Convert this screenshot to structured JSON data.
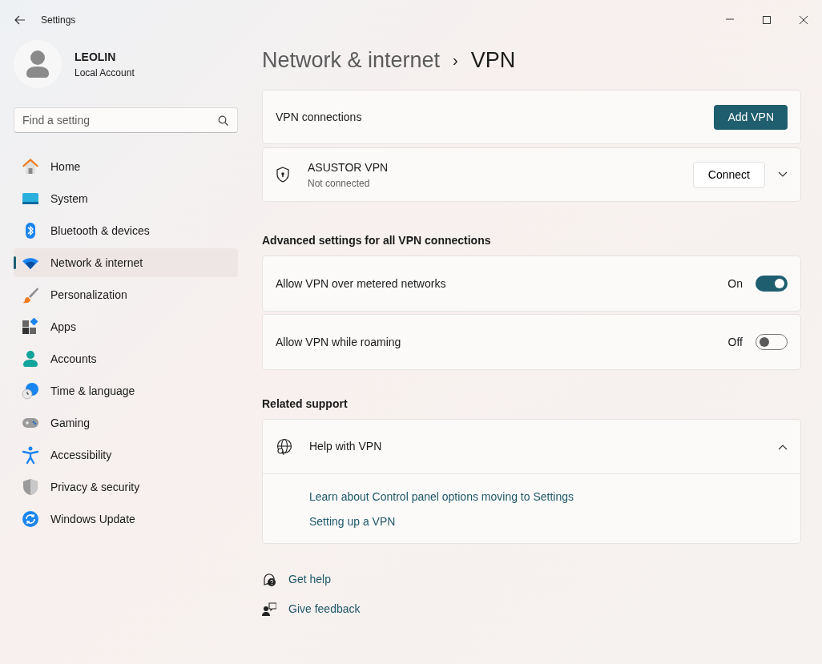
{
  "window": {
    "title": "Settings"
  },
  "account": {
    "name": "LEOLIN",
    "type": "Local Account"
  },
  "search": {
    "placeholder": "Find a setting"
  },
  "sidebar": {
    "items": [
      {
        "label": "Home",
        "selected": false
      },
      {
        "label": "System",
        "selected": false
      },
      {
        "label": "Bluetooth & devices",
        "selected": false
      },
      {
        "label": "Network & internet",
        "selected": true
      },
      {
        "label": "Personalization",
        "selected": false
      },
      {
        "label": "Apps",
        "selected": false
      },
      {
        "label": "Accounts",
        "selected": false
      },
      {
        "label": "Time & language",
        "selected": false
      },
      {
        "label": "Gaming",
        "selected": false
      },
      {
        "label": "Accessibility",
        "selected": false
      },
      {
        "label": "Privacy & security",
        "selected": false
      },
      {
        "label": "Windows Update",
        "selected": false
      }
    ]
  },
  "breadcrumb": {
    "parent": "Network & internet",
    "separator": "›",
    "current": "VPN"
  },
  "vpn_connections": {
    "label": "VPN connections",
    "button": "Add VPN"
  },
  "vpns": [
    {
      "name": "ASUSTOR VPN",
      "status": "Not connected",
      "button": "Connect",
      "expanded": false
    }
  ],
  "advanced": {
    "heading": "Advanced settings for all VPN connections",
    "settings": [
      {
        "label": "Allow VPN over metered networks",
        "state_text": "On",
        "on": true
      },
      {
        "label": "Allow VPN while roaming",
        "state_text": "Off",
        "on": false
      }
    ]
  },
  "related": {
    "heading": "Related support",
    "help": {
      "title": "Help with VPN",
      "expanded": true,
      "links": [
        "Learn about Control panel options moving to Settings",
        "Setting up a VPN"
      ]
    }
  },
  "footer_links": [
    "Get help",
    "Give feedback"
  ]
}
